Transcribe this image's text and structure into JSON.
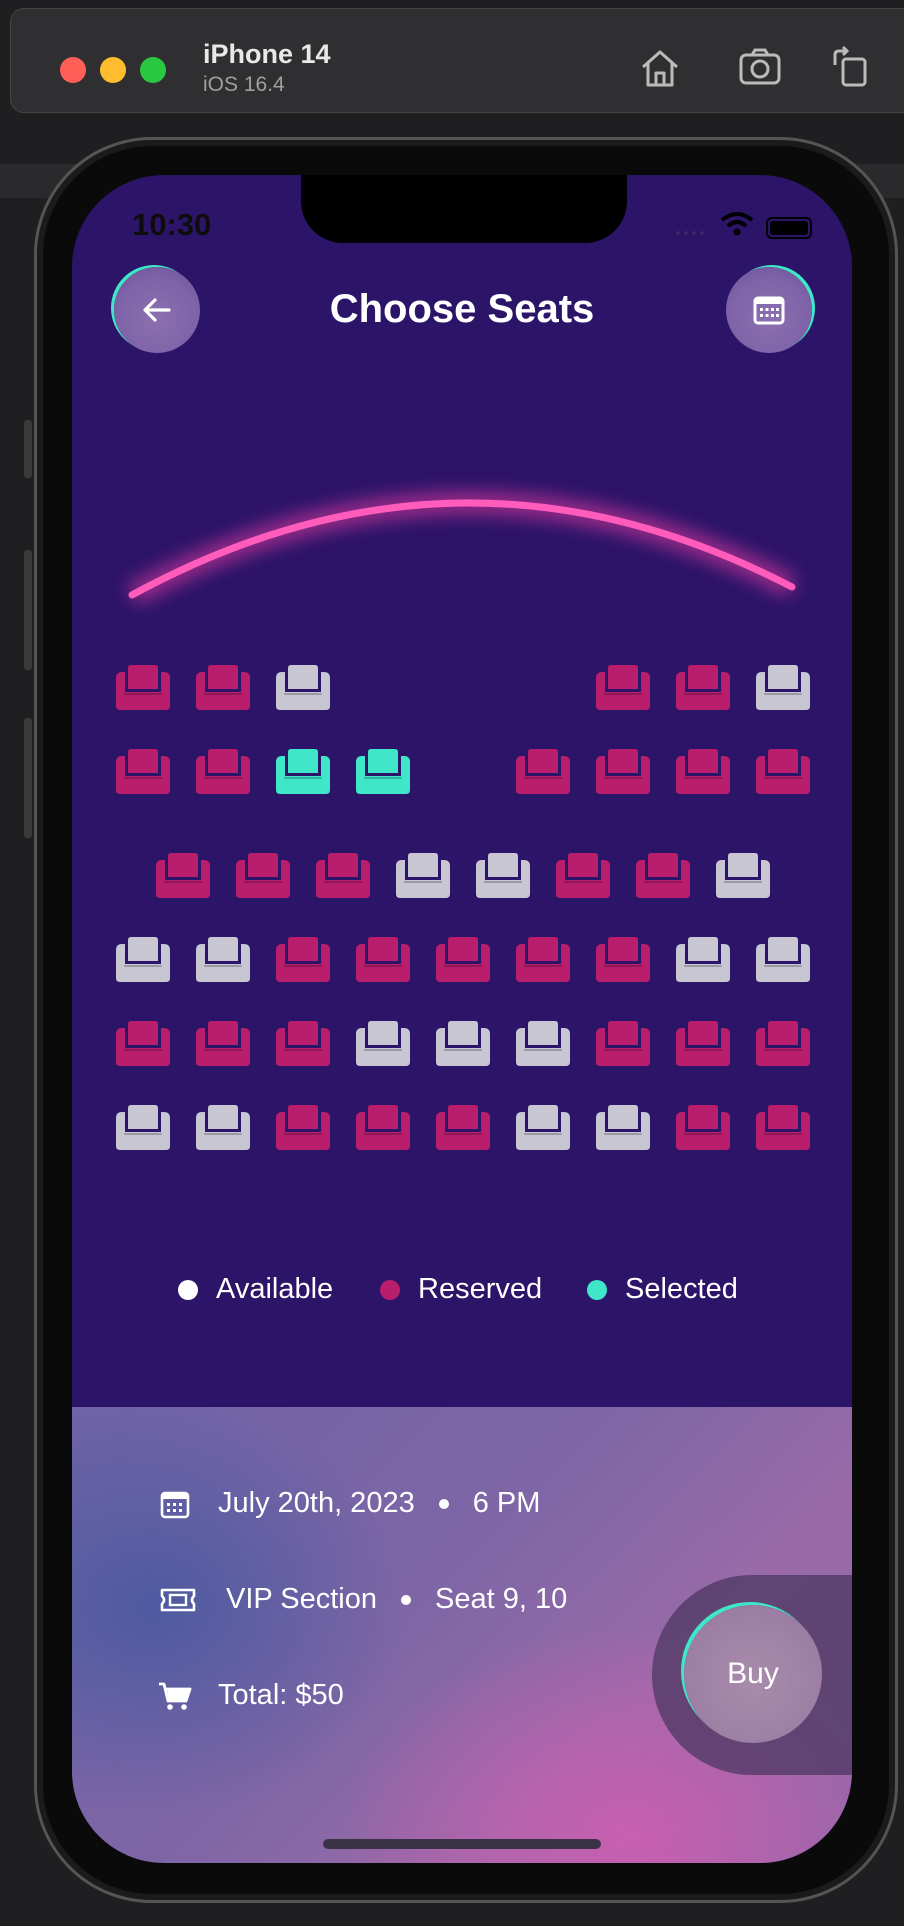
{
  "simulator": {
    "device_name": "iPhone 14",
    "os_version": "iOS 16.4",
    "toolbar_icons": [
      "home-icon",
      "screenshot-icon",
      "rotate-icon"
    ]
  },
  "status_bar": {
    "time": "10:30"
  },
  "header": {
    "title": "Choose Seats",
    "back_icon": "arrow-left-icon",
    "calendar_icon": "calendar-icon"
  },
  "colors": {
    "background": "#2c1468",
    "available": "#c9c6d3",
    "reserved": "#b81e6b",
    "selected": "#3fe6c8",
    "screen_glow": "#ff4fb0"
  },
  "seat_rows": [
    [
      "reserved",
      "reserved",
      "available",
      null,
      null,
      null,
      "reserved",
      "reserved",
      "available"
    ],
    [
      "reserved",
      "reserved",
      "selected",
      "selected",
      null,
      "reserved",
      "reserved",
      "reserved",
      "reserved"
    ],
    [
      "reserved",
      "reserved",
      "reserved",
      "available",
      "available",
      "reserved",
      "reserved",
      "available"
    ],
    [
      "available",
      "available",
      "reserved",
      "reserved",
      "reserved",
      "reserved",
      "reserved",
      "available",
      "available"
    ],
    [
      "reserved",
      "reserved",
      "reserved",
      "available",
      "available",
      "available",
      "reserved",
      "reserved",
      "reserved"
    ],
    [
      "available",
      "available",
      "reserved",
      "reserved",
      "reserved",
      "available",
      "available",
      "reserved",
      "reserved"
    ]
  ],
  "legend": {
    "available": "Available",
    "reserved": "Reserved",
    "selected": "Selected"
  },
  "booking": {
    "date": "July 20th, 2023",
    "time": "6 PM",
    "section": "VIP Section",
    "seats": "Seat 9, 10",
    "total": "Total: $50"
  },
  "buy_button": {
    "label": "Buy"
  }
}
